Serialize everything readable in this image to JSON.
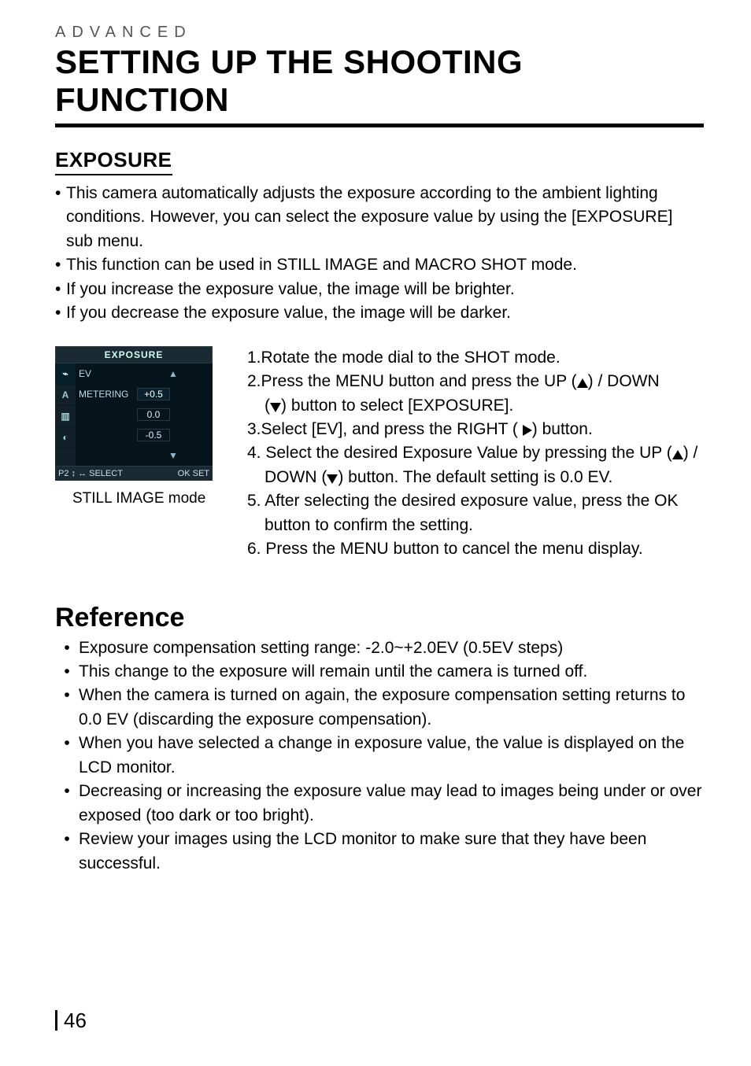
{
  "eyebrow": "ADVANCED",
  "title": "SETTING UP THE SHOOTING FUNCTION",
  "section_heading": "EXPOSURE",
  "intro_bullets": [
    "This camera automatically adjusts the exposure according to the ambient lighting conditions. However, you can select the exposure value by using the [EXPOSURE] sub menu.",
    "This function can be used in STILL IMAGE and MACRO SHOT mode.",
    "If you increase the exposure value, the image will be brighter.",
    "If you decrease the exposure value, the image will be darker."
  ],
  "lcd": {
    "header": "EXPOSURE",
    "tabs": [
      "⌁",
      "A",
      "▥",
      "◐"
    ],
    "rows": [
      {
        "label": "EV",
        "value": ""
      },
      {
        "label": "METERING",
        "value": "+0.5"
      },
      {
        "label": "",
        "value": "0.0"
      },
      {
        "label": "",
        "value": "-0.5"
      }
    ],
    "footer_left": "P2 ↕ ↔  SELECT",
    "footer_right": "OK  SET"
  },
  "caption": "STILL IMAGE mode",
  "steps": {
    "s1": "1.Rotate the mode dial to the SHOT mode.",
    "s2a": "2.Press the MENU button and press the UP (",
    "s2b": ") / DOWN",
    "s2c": "(",
    "s2d": ") button to select [EXPOSURE].",
    "s3a": "3.Select [EV], and press the RIGHT ( ",
    "s3b": ") button.",
    "s4a": "4. Select the desired Exposure Value by pressing the UP (",
    "s4b": ") /",
    "s4c": "DOWN (",
    "s4d": ") button. The default setting is 0.0 EV.",
    "s5a": "5. After selecting the desired exposure value, press the OK",
    "s5b": "button to confirm the setting.",
    "s6": "6. Press the MENU button to cancel the menu display."
  },
  "reference_heading": "Reference",
  "reference_bullets": [
    "Exposure compensation setting range: -2.0~+2.0EV (0.5EV steps)",
    "This change to the exposure will remain until the camera is turned off.",
    "When the camera is turned on again, the exposure compensation setting returns to 0.0 EV (discarding the exposure compensation).",
    "When you have selected a change in exposure value, the value is displayed on the LCD monitor.",
    "Decreasing or increasing the exposure value may lead to images being under or over exposed (too dark or too bright).",
    "Review your images using the LCD monitor to make sure that they have been successful."
  ],
  "page_number": "46"
}
